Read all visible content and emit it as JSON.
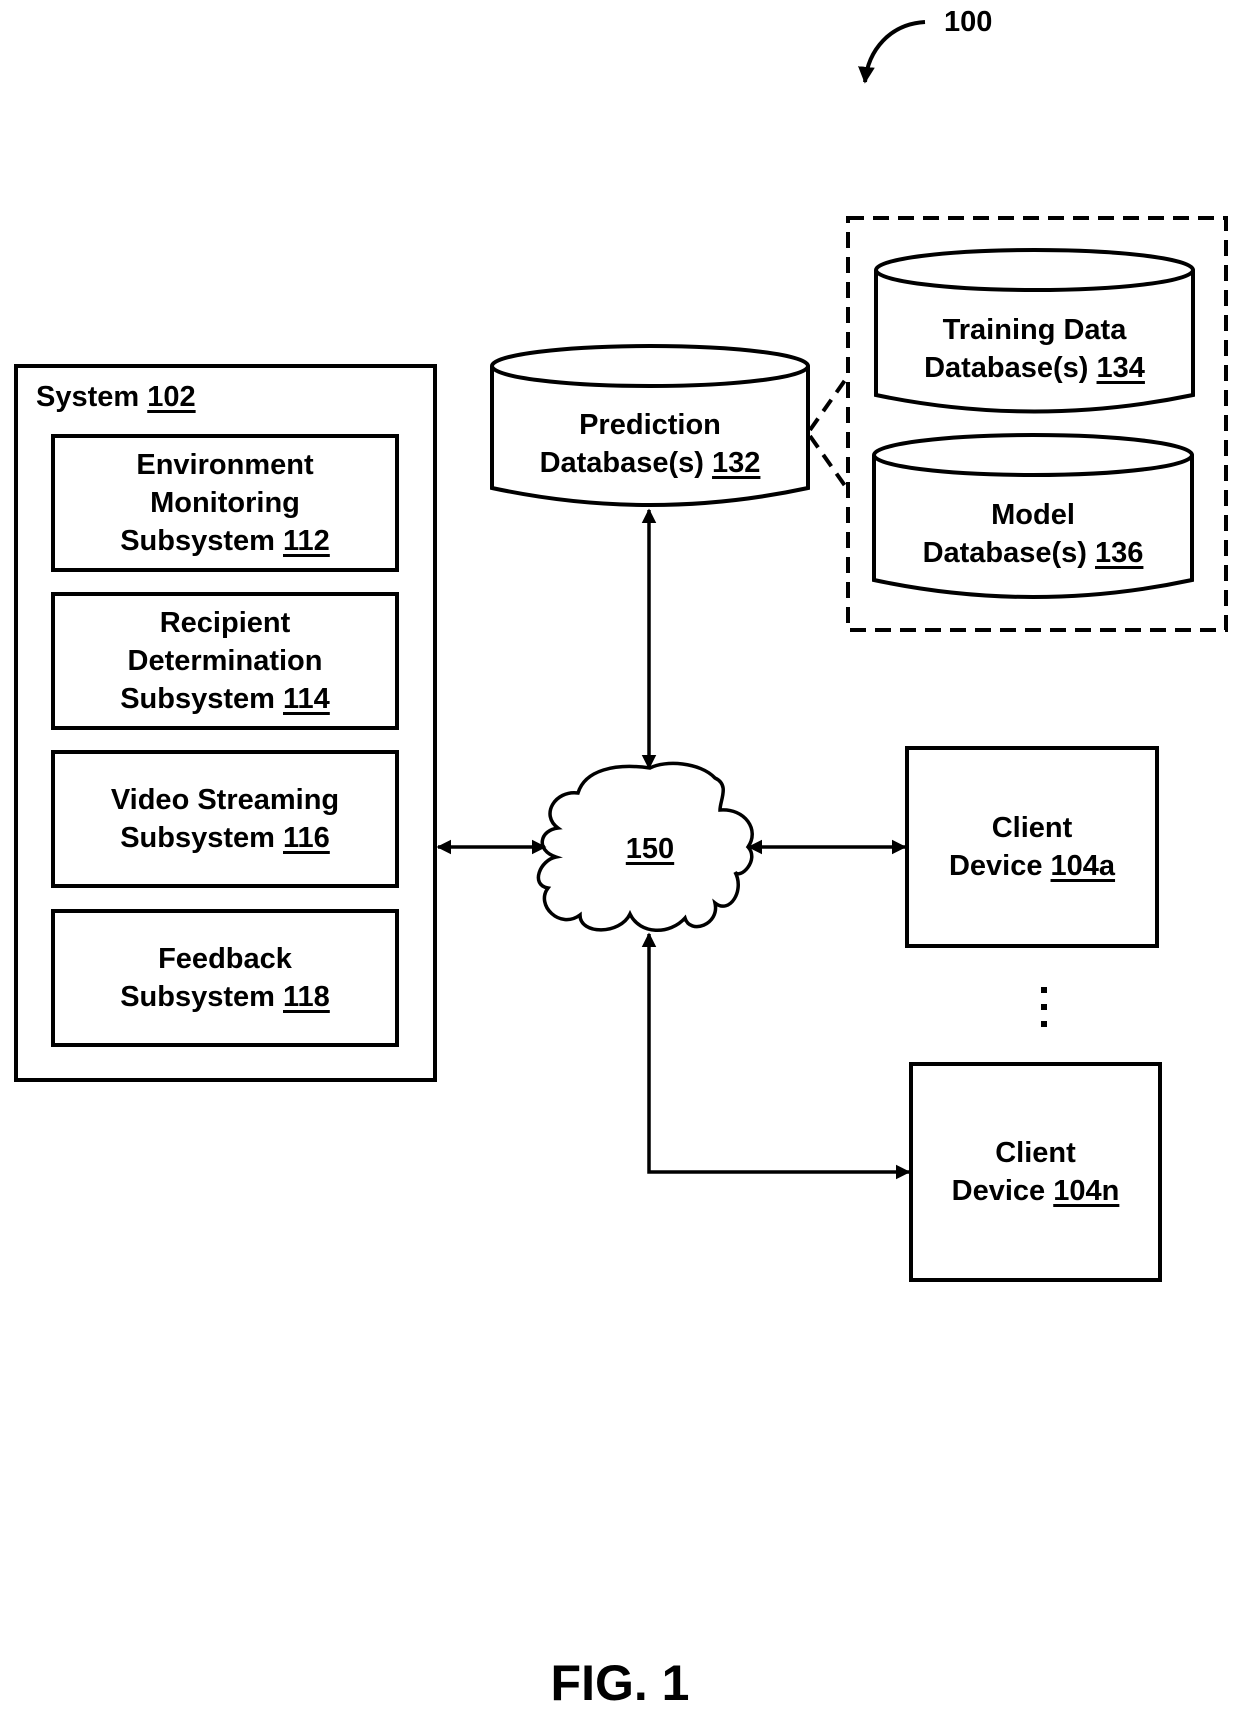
{
  "figure": {
    "reference_numeral": "100",
    "caption": "FIG. 1"
  },
  "system": {
    "title": "System",
    "ref": "102",
    "subsystems": [
      {
        "lines": [
          "Environment",
          "Monitoring"
        ],
        "last": "Subsystem",
        "ref": "112"
      },
      {
        "lines": [
          "Recipient",
          "Determination"
        ],
        "last": "Subsystem",
        "ref": "114"
      },
      {
        "lines": [
          "Video Streaming"
        ],
        "last": "Subsystem",
        "ref": "116"
      },
      {
        "lines": [
          "Feedback"
        ],
        "last": "Subsystem",
        "ref": "118"
      }
    ]
  },
  "databases": {
    "prediction": {
      "line1": "Prediction",
      "line2": "Database(s)",
      "ref": "132"
    },
    "training": {
      "line1": "Training Data",
      "line2": "Database(s)",
      "ref": "134"
    },
    "model": {
      "line1": "Model",
      "line2": "Database(s)",
      "ref": "136"
    }
  },
  "network": {
    "ref": "150"
  },
  "clients": [
    {
      "line1": "Client",
      "line2": "Device",
      "ref": "104a"
    },
    {
      "line1": "Client",
      "line2": "Device",
      "ref": "104n"
    }
  ],
  "ellipsis": "⋮"
}
